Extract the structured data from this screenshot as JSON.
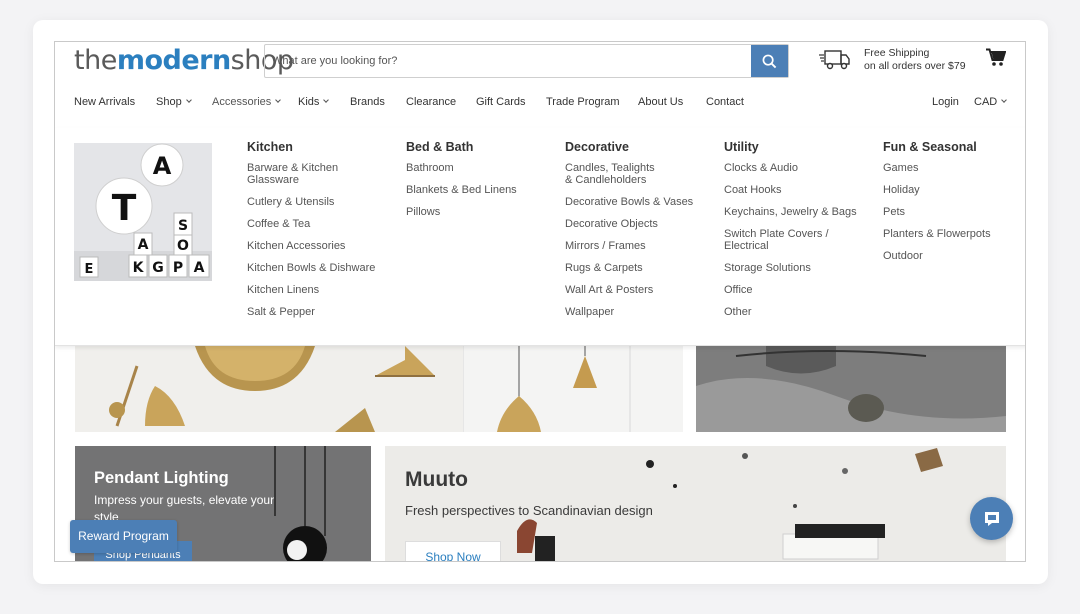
{
  "logo": {
    "part1": "the",
    "part2": "modern",
    "part3": "shop"
  },
  "search": {
    "placeholder": "What are you looking for?"
  },
  "shipping": {
    "line1": "Free Shipping",
    "line2": "on all orders over $79"
  },
  "nav": {
    "new_arrivals": "New Arrivals",
    "shop": "Shop",
    "accessories": "Accessories",
    "kids": "Kids",
    "brands": "Brands",
    "clearance": "Clearance",
    "gift_cards": "Gift Cards",
    "trade_program": "Trade Program",
    "about_us": "About Us",
    "contact": "Contact",
    "login": "Login",
    "currency": "CAD"
  },
  "mega_menu": {
    "columns": [
      {
        "title": "Kitchen",
        "links": [
          "Barware & Kitchen Glassware",
          "Cutlery & Utensils",
          "Coffee & Tea",
          "Kitchen Accessories",
          "Kitchen Bowls & Dishware",
          "Kitchen Linens",
          "Salt & Pepper"
        ]
      },
      {
        "title": "Bed & Bath",
        "links": [
          "Bathroom",
          "Blankets & Bed Linens",
          "Pillows"
        ]
      },
      {
        "title": "Decorative",
        "links": [
          "Candles, Tealights & Candleholders",
          "Decorative Bowls & Vases",
          "Decorative Objects",
          "Mirrors / Frames",
          "Rugs & Carpets",
          "Wall Art & Posters",
          "Wallpaper"
        ]
      },
      {
        "title": "Utility",
        "links": [
          "Clocks & Audio",
          "Coat Hooks",
          "Keychains, Jewelry & Bags",
          "Switch Plate Covers / Electrical",
          "Storage Solutions",
          "Office",
          "Other"
        ]
      },
      {
        "title": "Fun & Seasonal",
        "links": [
          "Games",
          "Holiday",
          "Pets",
          "Planters & Flowerpots",
          "Outdoor"
        ]
      }
    ],
    "image_letters": [
      "A",
      "T",
      "S",
      "O",
      "A",
      "K",
      "G",
      "P",
      "A",
      "E"
    ]
  },
  "banners": {
    "pendant": {
      "title": "Pendant Lighting",
      "subtitle": "Impress your guests, elevate your style",
      "button": "Shop Pendants"
    },
    "muuto": {
      "title": "Muuto",
      "subtitle": "Fresh perspectives to Scandinavian design",
      "button": "Shop Now"
    }
  },
  "reward": {
    "label": "Reward Program"
  },
  "colors": {
    "accent": "#4c7fb6",
    "logo_blue": "#2b7fbf"
  }
}
